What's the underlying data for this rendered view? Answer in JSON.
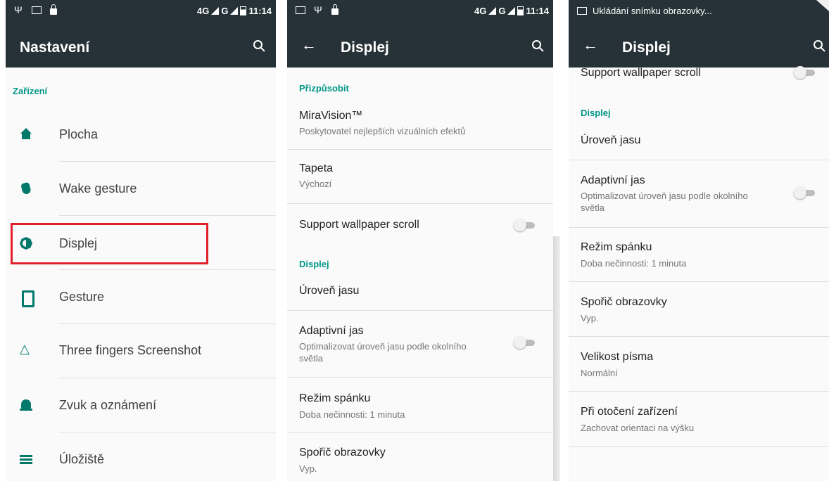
{
  "screen1": {
    "status": {
      "network": "4G",
      "network_sup": "4G",
      "time": "11:14"
    },
    "title": "Nastavení",
    "section": "Zařízení",
    "items": [
      {
        "label": "Plocha",
        "icon": "home-icon"
      },
      {
        "label": "Wake gesture",
        "icon": "hand-gesture-icon"
      },
      {
        "label": "Displej",
        "icon": "brightness-icon"
      },
      {
        "label": "Gesture",
        "icon": "phone-icon"
      },
      {
        "label": "Three fingers Screenshot",
        "icon": "triangle-icon"
      },
      {
        "label": "Zvuk a oznámení",
        "icon": "bell-icon"
      },
      {
        "label": "Úložiště",
        "icon": "storage-icon"
      }
    ],
    "highlight_color": "#e0212b"
  },
  "screen2": {
    "status": {
      "network": "4G",
      "network_sup": "4G",
      "time": "11:14"
    },
    "title": "Displej",
    "section1": "Přizpůsobit",
    "miravision": {
      "title": "MiraVision™",
      "subtitle": "Poskytovatel nejlepších vizuálních efektů"
    },
    "tapeta": {
      "title": "Tapeta",
      "subtitle": "Výchozí"
    },
    "wallpaper_scroll": {
      "title": "Support wallpaper scroll",
      "enabled": false
    },
    "section2": "Displej",
    "brightness": {
      "title": "Úroveň jasu"
    },
    "adaptive": {
      "title": "Adaptivní jas",
      "subtitle_line1": "Optimalizovat úroveň jasu podle okolního",
      "subtitle_line2": "světla",
      "enabled": false
    },
    "sleep": {
      "title": "Režim spánku",
      "subtitle": "Doba nečinnosti: 1 minuta"
    },
    "saver": {
      "title": "Spořič obrazovky",
      "subtitle": "Vyp."
    }
  },
  "screen3": {
    "status_text": "Ukládání snímku obrazovky...",
    "title": "Displej",
    "wallpaper_scroll": {
      "title": "Support wallpaper scroll",
      "enabled": false
    },
    "section": "Displej",
    "brightness": {
      "title": "Úroveň jasu"
    },
    "adaptive": {
      "title": "Adaptivní jas",
      "subtitle_line1": "Optimalizovat úroveň jasu podle okolního",
      "subtitle_line2": "světla",
      "enabled": false
    },
    "sleep": {
      "title": "Režim spánku",
      "subtitle": "Doba nečinnosti: 1 minuta"
    },
    "saver": {
      "title": "Spořič obrazovky",
      "subtitle": "Vyp."
    },
    "font_size": {
      "title": "Velikost písma",
      "subtitle": "Normální"
    },
    "rotation": {
      "title": "Při otočení zařízení",
      "subtitle": "Zachovat orientaci na výšku"
    }
  },
  "colors": {
    "toolbar": "#263238",
    "accent": "#009688",
    "icon": "#00796b"
  }
}
